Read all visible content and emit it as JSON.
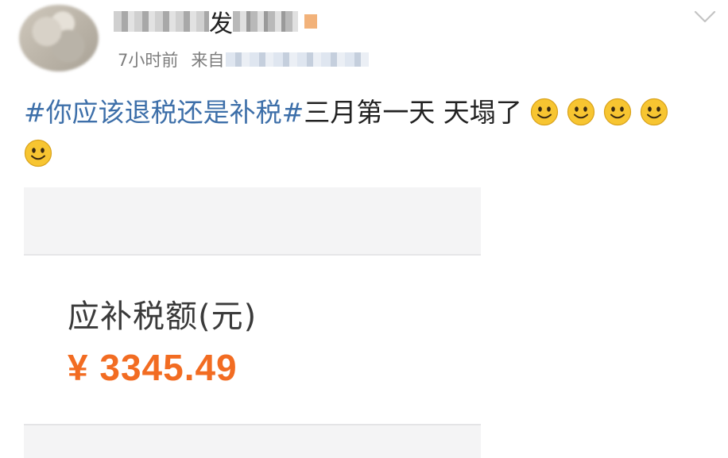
{
  "post": {
    "author": {
      "name_visible": "发"
    },
    "meta": {
      "time": "7小时前",
      "source_prefix": "来自"
    },
    "text": {
      "hashtag": "#你应该退税还是补税#",
      "body": "三月第一天 天塌了"
    },
    "emoji_icon": "smile-emoji",
    "emoji_count": 5
  },
  "card": {
    "label": "应补税额(元)",
    "amount": "¥ 3345.49"
  },
  "colors": {
    "hashtag": "#3d6fa9",
    "amount": "#f26c22",
    "emoji": "#f7c531"
  }
}
